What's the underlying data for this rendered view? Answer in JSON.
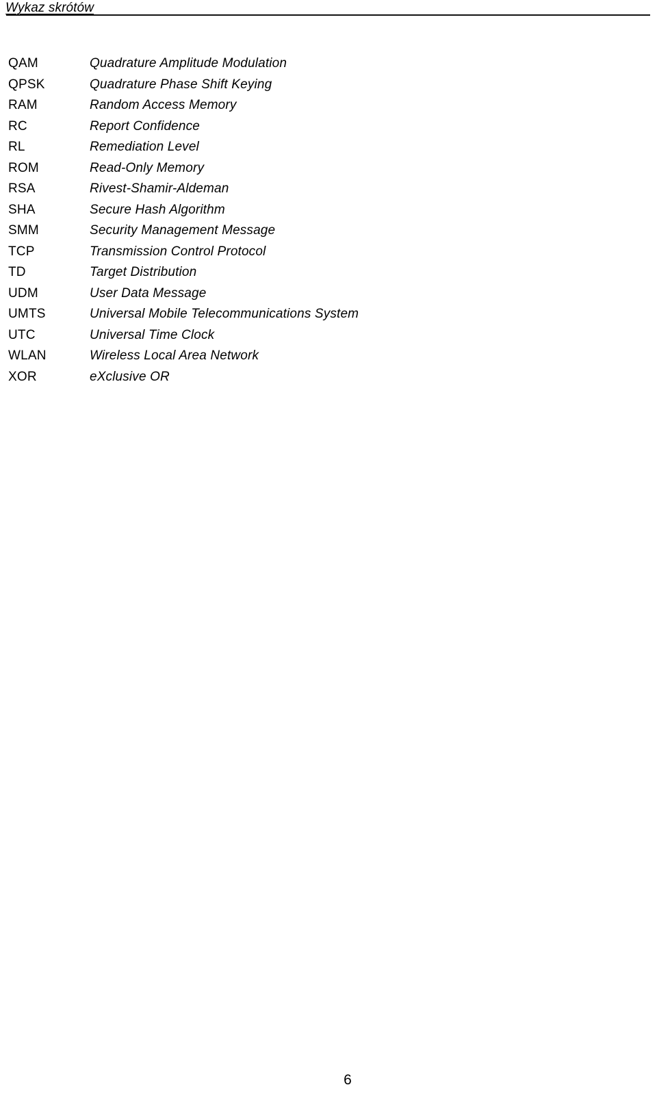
{
  "document": {
    "header": {
      "title": "Wykaz skrótów",
      "rule_color": "#121212"
    },
    "footer": {
      "page_number": "6"
    },
    "abbreviations": [
      {
        "term": "QAM",
        "definition": "Quadrature Amplitude Modulation"
      },
      {
        "term": "QPSK",
        "definition": "Quadrature Phase Shift Keying"
      },
      {
        "term": "RAM",
        "definition": "Random Access Memory"
      },
      {
        "term": "RC",
        "definition": "Report Confidence"
      },
      {
        "term": "RL",
        "definition": "Remediation Level"
      },
      {
        "term": "ROM",
        "definition": "Read-Only Memory"
      },
      {
        "term": "RSA",
        "definition": "Rivest-Shamir-Aldeman"
      },
      {
        "term": "SHA",
        "definition": "Secure Hash Algorithm"
      },
      {
        "term": "SMM",
        "definition": "Security Management Message"
      },
      {
        "term": "TCP",
        "definition": "Transmission Control Protocol"
      },
      {
        "term": "TD",
        "definition": "Target Distribution"
      },
      {
        "term": "UDM",
        "definition": "User Data Message"
      },
      {
        "term": "UMTS",
        "definition": "Universal Mobile Telecommunications System"
      },
      {
        "term": "UTC",
        "definition": "Universal Time Clock"
      },
      {
        "term": "WLAN",
        "definition": "Wireless Local Area Network"
      },
      {
        "term": "XOR",
        "definition": "eXclusive OR"
      }
    ]
  }
}
